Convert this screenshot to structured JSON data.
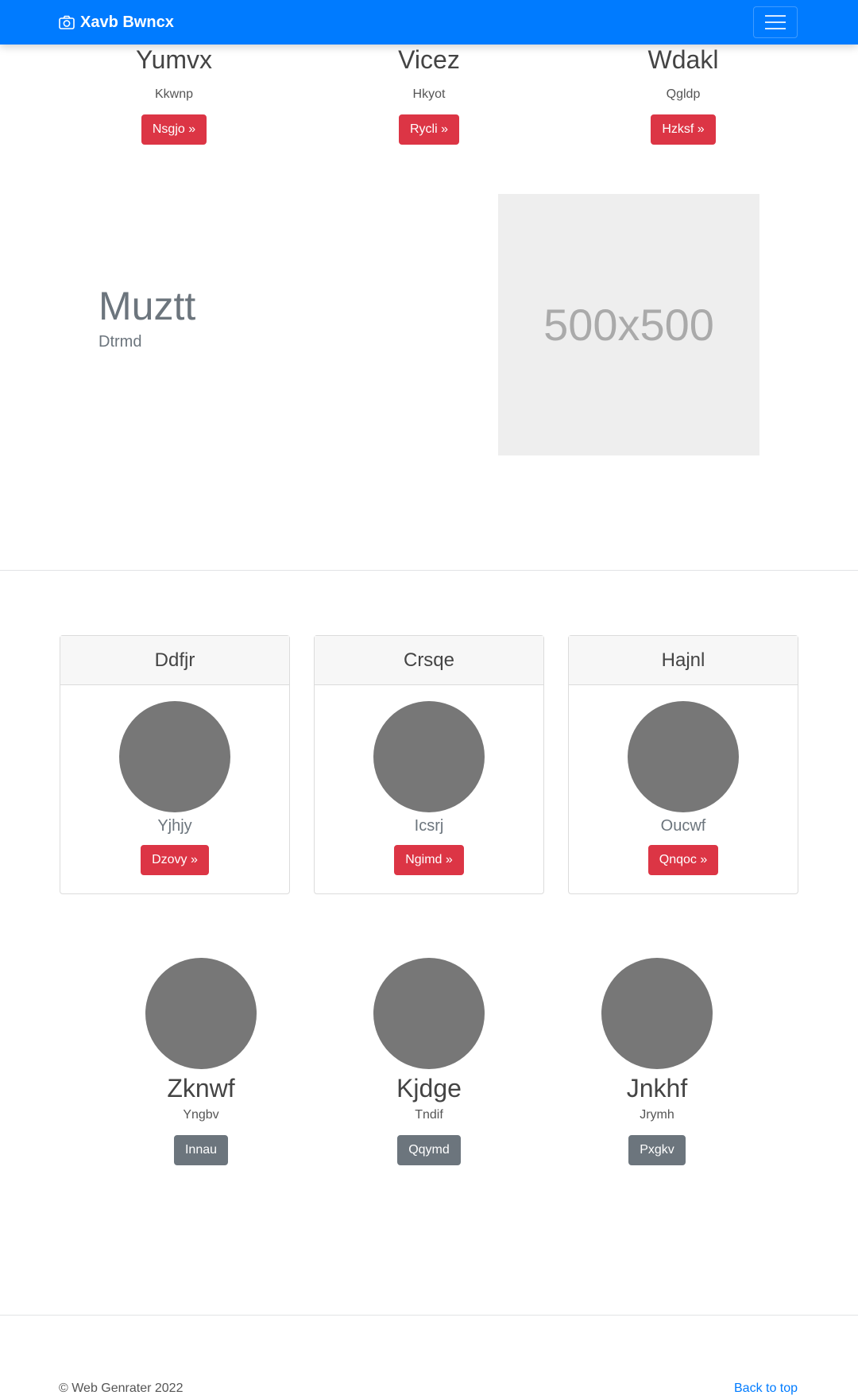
{
  "navbar": {
    "brand": "Xavb Bwncx",
    "icon": "camera-icon",
    "toggler": "menu-icon",
    "color": "#007bff"
  },
  "top_columns": [
    {
      "title": "Yumvx",
      "sub": "Kkwnp",
      "button": "Nsgjo »"
    },
    {
      "title": "Vicez",
      "sub": "Hkyot",
      "button": "Rycli »"
    },
    {
      "title": "Wdakl",
      "sub": "Qgldp",
      "button": "Hzksf »"
    }
  ],
  "feature": {
    "title": "Muztt",
    "sub": "Dtrmd",
    "placeholder": "500x500"
  },
  "cards": [
    {
      "header": "Ddfjr",
      "sub": "Yjhjy",
      "button": "Dzovy »"
    },
    {
      "header": "Crsqe",
      "sub": "Icsrj",
      "button": "Ngimd »"
    },
    {
      "header": "Hajnl",
      "sub": "Oucwf",
      "button": "Qnqoc »"
    }
  ],
  "people": [
    {
      "name": "Zknwf",
      "sub": "Yngbv",
      "button": "Innau"
    },
    {
      "name": "Kjdge",
      "sub": "Tndif",
      "button": "Qqymd"
    },
    {
      "name": "Jnkhf",
      "sub": "Jrymh",
      "button": "Pxgkv"
    }
  ],
  "footer": {
    "copyright": "© Web Genrater 2022",
    "back_to_top": "Back to top"
  },
  "colors": {
    "primary": "#007bff",
    "danger": "#dc3545",
    "secondary": "#6c757d",
    "placeholder_bg": "#eeeeee",
    "avatar": "#777777"
  }
}
